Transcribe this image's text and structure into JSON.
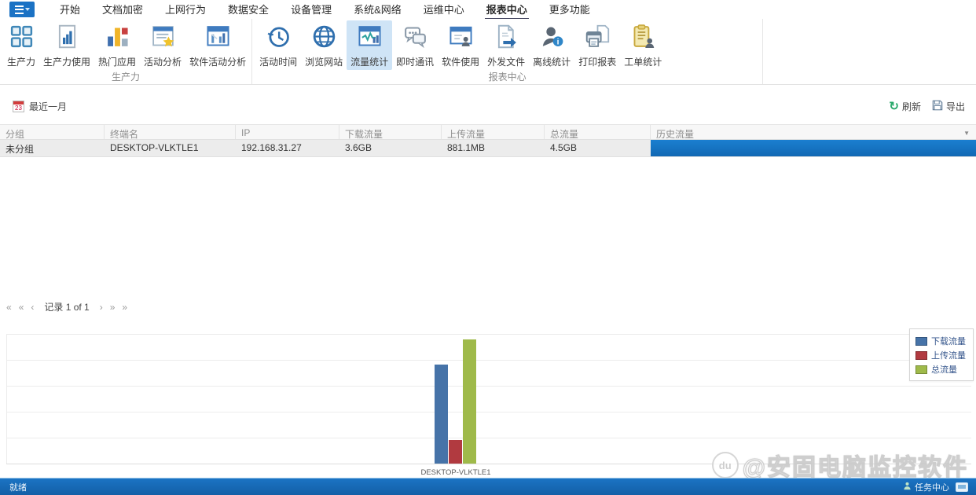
{
  "menu": {
    "tabs": [
      {
        "label": "开始"
      },
      {
        "label": "文档加密"
      },
      {
        "label": "上网行为"
      },
      {
        "label": "数据安全"
      },
      {
        "label": "设备管理"
      },
      {
        "label": "系统&网络"
      },
      {
        "label": "运维中心"
      },
      {
        "label": "报表中心"
      },
      {
        "label": "更多功能"
      }
    ],
    "active_tab": "报表中心"
  },
  "ribbon": {
    "groups": [
      {
        "title": "生产力",
        "items": [
          {
            "label": "生产力",
            "icon": "grid-icon"
          },
          {
            "label": "生产力使用",
            "icon": "doc-chart-icon"
          },
          {
            "label": "热门应用",
            "icon": "hot-apps-icon"
          },
          {
            "label": "活动分析",
            "icon": "doc-star-icon"
          },
          {
            "label": "软件活动分析",
            "icon": "window-chart-icon"
          }
        ]
      },
      {
        "title": "报表中心",
        "items": [
          {
            "label": "活动时间",
            "icon": "clock-history-icon"
          },
          {
            "label": "浏览网站",
            "icon": "globe-icon"
          },
          {
            "label": "流量统计",
            "icon": "traffic-pulse-icon",
            "active": true
          },
          {
            "label": "即时通讯",
            "icon": "chat-icon"
          },
          {
            "label": "软件使用",
            "icon": "window-user-icon"
          },
          {
            "label": "外发文件",
            "icon": "doc-export-icon"
          },
          {
            "label": "离线统计",
            "icon": "user-info-icon"
          },
          {
            "label": "打印报表",
            "icon": "printer-icon"
          },
          {
            "label": "工单统计",
            "icon": "clipboard-user-icon"
          }
        ]
      }
    ]
  },
  "toolbar": {
    "date_filter": "最近一月",
    "calendar_day": "23",
    "refresh_label": "刷新",
    "export_label": "导出"
  },
  "table": {
    "columns": [
      "分组",
      "终端名",
      "IP",
      "下载流量",
      "上传流量",
      "总流量",
      "历史流量"
    ],
    "rows": [
      {
        "group": "未分组",
        "terminal": "DESKTOP-VLKTLE1",
        "ip": "192.168.31.27",
        "download": "3.6GB",
        "upload": "881.1MB",
        "total": "4.5GB"
      }
    ]
  },
  "pagination": {
    "first": "«",
    "prev_page": "«",
    "prev": "‹",
    "record_text": "记录 1 of 1",
    "next": "›",
    "next_page": "»",
    "last": "»"
  },
  "chart_data": {
    "type": "bar",
    "categories": [
      "DESKTOP-VLKTLE1"
    ],
    "series": [
      {
        "name": "下载流量",
        "value_gb": 3.6,
        "label": "3.6GB",
        "color": "#4673a8"
      },
      {
        "name": "上传流量",
        "value_gb": 0.86,
        "label": "881.1MB",
        "color": "#b13a40"
      },
      {
        "name": "总流量",
        "value_gb": 4.5,
        "label": "4.5GB",
        "color": "#9fba4a"
      }
    ],
    "ylim_gb": [
      0,
      4.7
    ],
    "grid": true,
    "legend_position": "top-right"
  },
  "watermark": {
    "logo_text": "du",
    "text": "@安固电脑监控软件"
  },
  "statusbar": {
    "left": "就绪",
    "task_center": "任务中心"
  },
  "colors": {
    "accent_blue": "#1b72c4",
    "history_bar": "#1373c4",
    "refresh_green": "#2aa96b",
    "ribbon_active_bg": "#cfe4f6"
  }
}
